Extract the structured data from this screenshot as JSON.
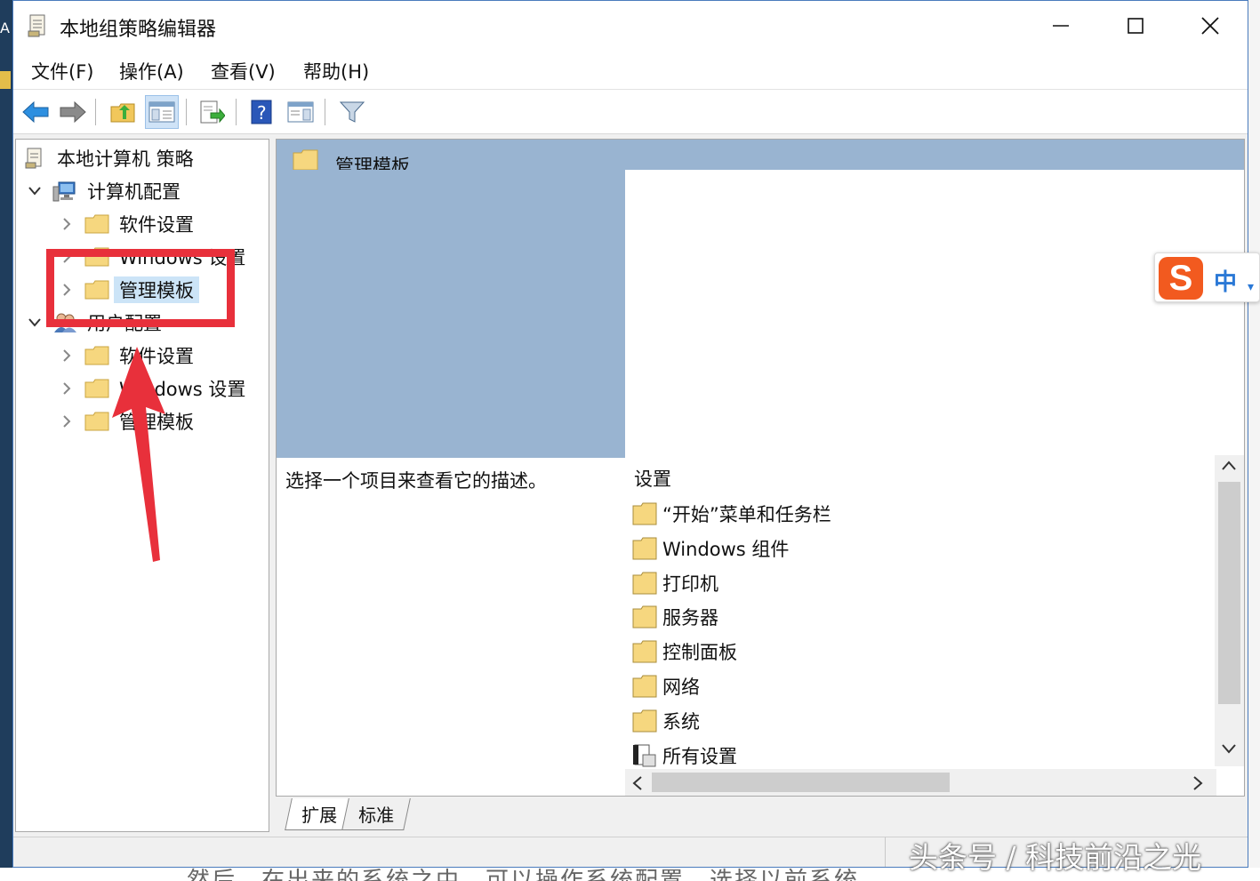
{
  "window": {
    "title": "本地组策略编辑器"
  },
  "menu": {
    "file": "文件(F)",
    "action": "操作(A)",
    "view": "查看(V)",
    "help": "帮助(H)"
  },
  "tree": {
    "root": "本地计算机 策略",
    "computer_config": "计算机配置",
    "cc_software": "软件设置",
    "cc_windows": "Windows 设置",
    "cc_admin": "管理模板",
    "user_config": "用户配置",
    "uc_software": "软件设置",
    "uc_windows": "Windows 设置",
    "uc_admin": "管理模板"
  },
  "right": {
    "header_title": "管理模板",
    "description": "选择一个项目来查看它的描述。",
    "list_header": "设置",
    "items": [
      "“开始”菜单和任务栏",
      "Windows 组件",
      "打印机",
      "服务器",
      "控制面板",
      "网络",
      "系统",
      "所有设置"
    ]
  },
  "tabs": {
    "expanded": "扩展",
    "standard": "标准"
  },
  "overlay": {
    "ime_lang": "中",
    "ime_logo": "S",
    "watermark": "头条号 / 科技前沿之光"
  },
  "background": {
    "left_letter": "A",
    "bottom_text": "然后，在出来的系统之中，可以操作系统配置，选择以前系统"
  },
  "colors": {
    "selection_header": "#99b4d1",
    "highlight": "#e8303b",
    "tree_selected": "#cce4f7",
    "ime_brand": "#f25a1f"
  }
}
